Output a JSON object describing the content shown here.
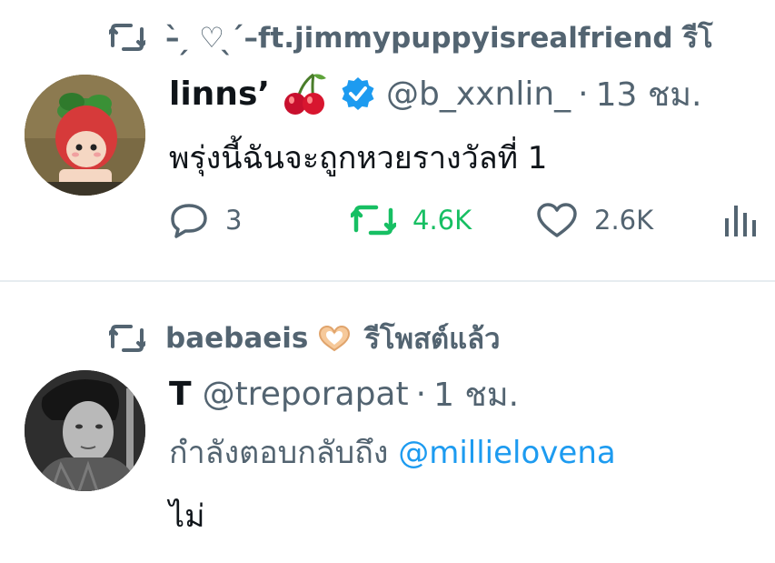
{
  "tweet1": {
    "retweeted_by": "–̀ ̗ ♡ ̖ ́–ft.jimmypuppyisrealfriend รีโ",
    "display_name": "linns’",
    "handle": "@b_xxnlin_",
    "dot": "·",
    "time": "13 ชม.",
    "text": "พรุ่งนี้ฉันจะถูกหวยรางวัลที่ 1",
    "replies": "3",
    "retweets": "4.6K",
    "likes": "2.6K"
  },
  "tweet2": {
    "retweeted_by": "baebaeis",
    "retweet_label": "รีโพสต์แล้ว",
    "display_name": "T",
    "handle": "@treporapat",
    "dot": "·",
    "time": "1 ชม.",
    "reply_prefix": "กำลังตอบกลับถึง",
    "reply_to": "@millielovena",
    "text": "ไม่"
  },
  "icons": {
    "retweet": "retweet-icon",
    "reply": "reply-icon",
    "like": "heart-icon",
    "analytics": "analytics-icon",
    "verified": "verified-badge-icon",
    "cherry": "cherry-emoji-icon",
    "heart_hands": "heart-hands-emoji-icon"
  },
  "colors": {
    "text_primary": "#0f1419",
    "text_secondary": "#536471",
    "retweet_active": "#17bf63",
    "link": "#1d9bf0",
    "verified": "#1d9bf0",
    "divider": "#e6ecf0"
  }
}
